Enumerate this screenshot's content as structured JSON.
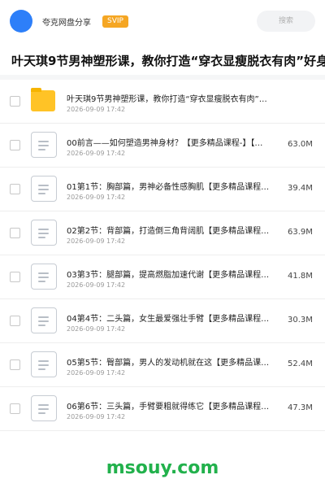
{
  "header": {
    "share_name": "夸克网盘分享",
    "badge": "SVIP",
    "search_placeholder": "搜索"
  },
  "page_title": "叶天琪9节男神塑形课，教你打造“穿衣显瘦脱衣有肉”好身",
  "files": [
    {
      "name": "叶天琪9节男神塑形课，教你打造“穿衣显瘦脱衣有肉”…",
      "date": "2026-09-09 17:42",
      "size": "",
      "type": "folder"
    },
    {
      "name": "00前言——如何塑造男神身材？【更多精品课程-】【…",
      "date": "2026-09-09 17:42",
      "size": "63.0M",
      "type": "file"
    },
    {
      "name": "01第1节：胸部篇，男神必备性感胸肌【更多精品课程…",
      "date": "2026-09-09 17:42",
      "size": "39.4M",
      "type": "file"
    },
    {
      "name": "02第2节：背部篇，打造倒三角背阔肌【更多精品课程…",
      "date": "2026-09-09 17:42",
      "size": "63.9M",
      "type": "file"
    },
    {
      "name": "03第3节：腿部篇，提高燃脂加速代谢【更多精品课程…",
      "date": "2026-09-09 17:42",
      "size": "41.8M",
      "type": "file"
    },
    {
      "name": "04第4节：二头篇，女生最爱强壮手臂【更多精品课程…",
      "date": "2026-09-09 17:42",
      "size": "30.3M",
      "type": "file"
    },
    {
      "name": "05第5节：臀部篇，男人的发动机就在这【更多精品课…",
      "date": "2026-09-09 17:42",
      "size": "52.4M",
      "type": "file"
    },
    {
      "name": "06第6节：三头篇，手臂要粗就得练它【更多精品课程…",
      "date": "2026-09-09 17:42",
      "size": "47.3M",
      "type": "file"
    }
  ],
  "watermark": "msouy.com",
  "colors": {
    "accent": "#2d7ff9",
    "badge": "#f5a623",
    "folder": "#ffc326",
    "watermark": "#22b14c"
  }
}
